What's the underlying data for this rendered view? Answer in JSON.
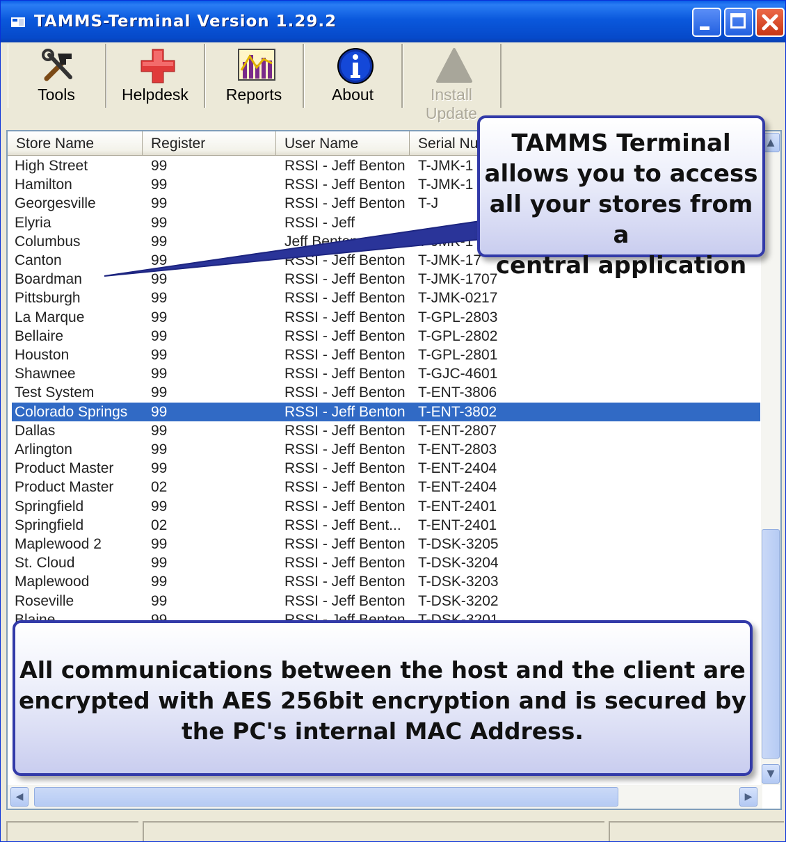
{
  "window": {
    "title": "TAMMS-Terminal  Version 1.29.2",
    "minimize_label": "_",
    "maximize_label": "□",
    "close_label": "✕"
  },
  "toolbar": {
    "items": [
      {
        "label": "Tools",
        "icon": "tools-icon",
        "enabled": true
      },
      {
        "label": "Helpdesk",
        "icon": "red-cross-icon",
        "enabled": true
      },
      {
        "label": "Reports",
        "icon": "bar-chart-icon",
        "enabled": true
      },
      {
        "label": "About",
        "icon": "info-icon",
        "enabled": true
      },
      {
        "label": "Install Update",
        "icon": "triangle-icon",
        "enabled": false
      }
    ]
  },
  "list": {
    "columns": [
      "Store Name",
      "Register",
      "User Name",
      "Serial Nu"
    ],
    "rows": [
      [
        "High Street",
        "99",
        "RSSI - Jeff Benton",
        "T-JMK-1"
      ],
      [
        "Hamilton",
        "99",
        "RSSI - Jeff Benton",
        "T-JMK-1"
      ],
      [
        "Georgesville",
        "99",
        "RSSI - Jeff Benton",
        "T-J"
      ],
      [
        "Elyria",
        "99",
        "RSSI - Jeff",
        ""
      ],
      [
        "Columbus",
        "99",
        "Jeff Benton",
        "T-JMK-1"
      ],
      [
        "Canton",
        "99",
        "RSSI - Jeff Benton",
        "T-JMK-17"
      ],
      [
        "Boardman",
        "99",
        "RSSI - Jeff Benton",
        "T-JMK-1707"
      ],
      [
        "Pittsburgh",
        "99",
        "RSSI - Jeff Benton",
        "T-JMK-0217"
      ],
      [
        "La Marque",
        "99",
        "RSSI - Jeff Benton",
        "T-GPL-2803"
      ],
      [
        "Bellaire",
        "99",
        "RSSI - Jeff Benton",
        "T-GPL-2802"
      ],
      [
        "Houston",
        "99",
        "RSSI - Jeff Benton",
        "T-GPL-2801"
      ],
      [
        "Shawnee",
        "99",
        "RSSI - Jeff Benton",
        "T-GJC-4601"
      ],
      [
        "Test System",
        "99",
        "RSSI - Jeff Benton",
        "T-ENT-3806"
      ],
      [
        "Colorado Springs",
        "99",
        "RSSI - Jeff Benton",
        "T-ENT-3802"
      ],
      [
        "Dallas",
        "99",
        "RSSI - Jeff Benton",
        "T-ENT-2807"
      ],
      [
        "Arlington",
        "99",
        "RSSI - Jeff Benton",
        "T-ENT-2803"
      ],
      [
        "Product Master",
        "99",
        "RSSI - Jeff Benton",
        "T-ENT-2404"
      ],
      [
        "Product Master",
        "02",
        "RSSI - Jeff Benton",
        "T-ENT-2404"
      ],
      [
        "Springfield",
        "99",
        "RSSI - Jeff Benton",
        "T-ENT-2401"
      ],
      [
        "Springfield",
        "02",
        "RSSI - Jeff Bent...",
        "T-ENT-2401"
      ],
      [
        "Maplewood 2",
        "99",
        "RSSI - Jeff Benton",
        "T-DSK-3205"
      ],
      [
        "St. Cloud",
        "99",
        "RSSI - Jeff Benton",
        "T-DSK-3204"
      ],
      [
        "Maplewood",
        "99",
        "RSSI - Jeff Benton",
        "T-DSK-3203"
      ],
      [
        "Roseville",
        "99",
        "RSSI - Jeff Benton",
        "T-DSK-3202"
      ],
      [
        "Blaine",
        "99",
        "RSSI - Jeff Benton",
        "T-DSK-3201"
      ]
    ],
    "selected_index": 13
  },
  "callouts": {
    "top_lines": [
      "TAMMS Terminal",
      "allows you to access",
      "all your stores from a",
      "central application"
    ],
    "bottom_lines": [
      "All communications between the host and the client are",
      "encrypted with AES 256bit encryption and is secured by",
      "the PC's internal MAC Address."
    ]
  },
  "colors": {
    "selection": "#316ac5",
    "titlebar": "#0a58dc",
    "callout_border": "#323aa8"
  }
}
